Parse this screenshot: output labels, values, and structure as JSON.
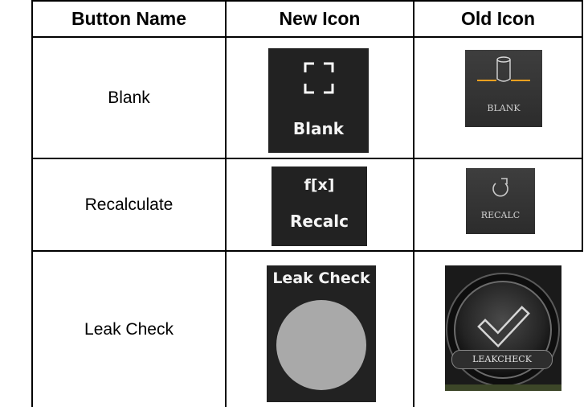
{
  "headers": [
    "Button Name",
    "New Icon",
    "Old Icon"
  ],
  "rows": [
    {
      "name": "Blank",
      "new_label": "Blank",
      "new_icon": "frame-corners-icon",
      "old_label": "BLANK",
      "old_icon": "blank-cylinder-icon"
    },
    {
      "name": "Recalculate",
      "new_label": "Recalc",
      "new_glyph": "f[x]",
      "new_icon": "function-icon",
      "old_label": "RECALC",
      "old_icon": "recalc-arrow-icon"
    },
    {
      "name": "Leak Check",
      "new_label": "Leak Check",
      "new_icon": "gray-circle-icon",
      "old_label": "LEAKCHECK",
      "old_icon": "checkmark-icon"
    }
  ],
  "colors": {
    "dark_bg": "#222222",
    "accent_orange": "#f0a020",
    "circle_gray": "#a9a9a9"
  }
}
